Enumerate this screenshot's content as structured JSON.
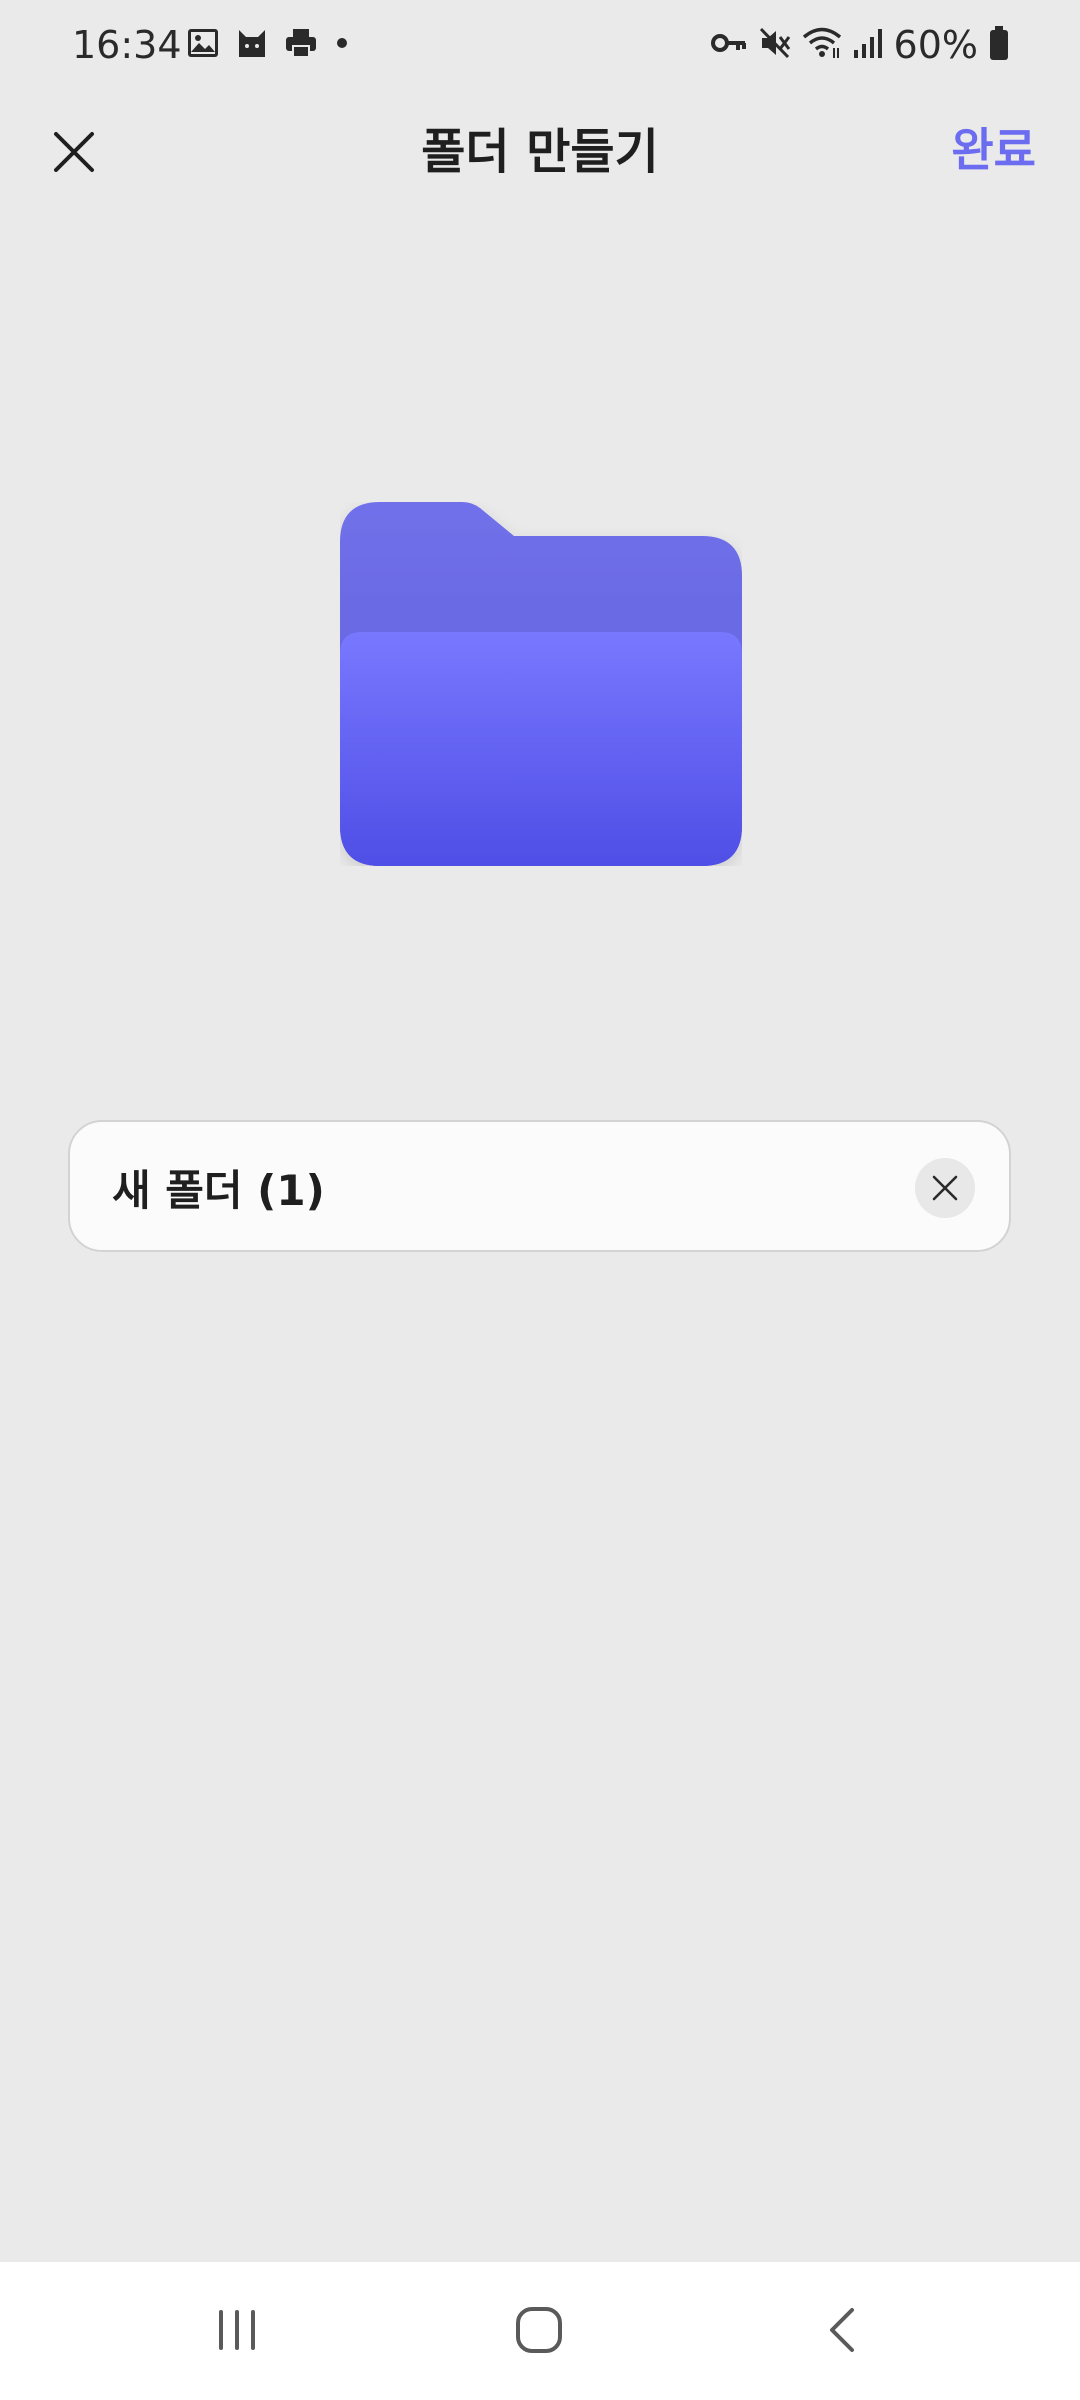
{
  "status_bar": {
    "time": "16:34",
    "battery_percent": "60%",
    "left_icons": [
      "gallery-icon",
      "cat-app-icon",
      "print-icon",
      "dot-icon"
    ],
    "right_icons": [
      "vpn-key-icon",
      "mute-icon",
      "wifi-icon",
      "signal-icon",
      "battery-icon"
    ]
  },
  "app_bar": {
    "title": "폴더 만들기",
    "done_label": "완료",
    "close_icon": "close-icon"
  },
  "folder": {
    "icon": "folder-icon",
    "color_back": "#6b6ae6",
    "color_front_top": "#7777ff",
    "color_front_bottom": "#5050e8"
  },
  "name_field": {
    "value": "새 폴더 (1)",
    "clear_icon": "clear-icon"
  },
  "nav_bar": {
    "recent_icon": "recent-apps-icon",
    "home_icon": "home-icon",
    "back_icon": "back-icon"
  },
  "colors": {
    "accent": "#6c6cf0",
    "background": "#eaeaeb"
  }
}
